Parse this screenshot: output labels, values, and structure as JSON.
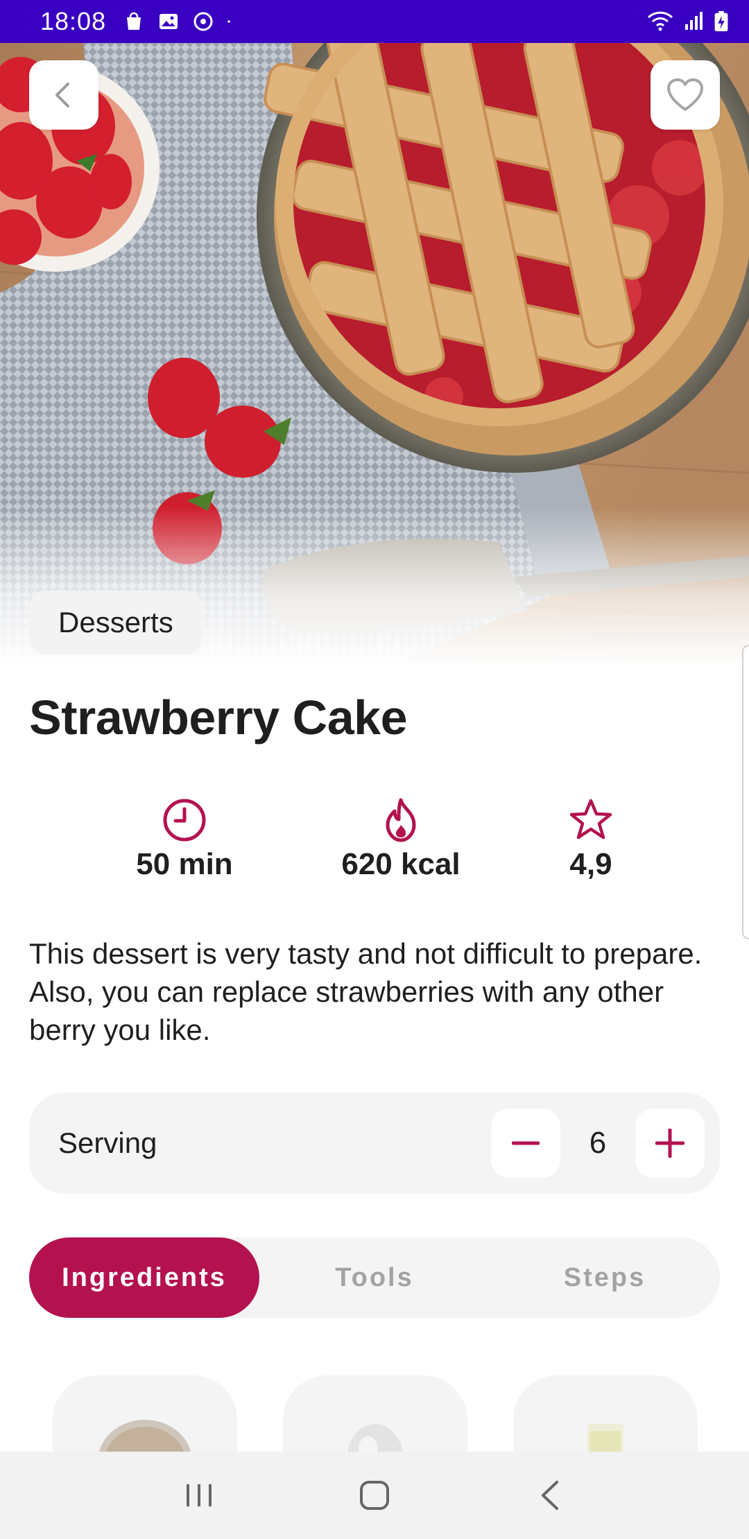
{
  "status_bar": {
    "time": "18:08",
    "left_icons": [
      "bag-icon",
      "image-icon",
      "sync-icon",
      "dot-icon"
    ],
    "right_icons": [
      "wifi-icon",
      "signal-icon",
      "battery-charging-icon"
    ],
    "background": "#3a00c2"
  },
  "header": {
    "back_icon": "chevron-left-icon",
    "favorite_icon": "heart-outline-icon"
  },
  "recipe": {
    "category": "Desserts",
    "title": "Strawberry Cake",
    "stats": [
      {
        "icon": "clock-icon",
        "value": "50 min"
      },
      {
        "icon": "flame-icon",
        "value": "620 kcal"
      },
      {
        "icon": "star-icon",
        "value": "4,9"
      }
    ],
    "description": "This dessert is very tasty and not difficult to prepare. Also, you can replace strawberries with any other berry you like."
  },
  "serving": {
    "label": "Serving",
    "value": "6",
    "decrement_icon": "minus-icon",
    "increment_icon": "plus-icon"
  },
  "tabs": [
    {
      "label": "Ingredients",
      "active": true
    },
    {
      "label": "Tools",
      "active": false
    },
    {
      "label": "Steps",
      "active": false
    }
  ],
  "ingredients": [
    {
      "icon": "flour-bowl-icon"
    },
    {
      "icon": "egg-icon"
    },
    {
      "icon": "milk-glass-icon"
    }
  ],
  "nav_bar": {
    "buttons": [
      "recent-apps-icon",
      "home-icon",
      "back-icon"
    ]
  },
  "colors": {
    "accent": "#b3124f",
    "tab_inactive_text": "#a3a3a3",
    "surface": "#f4f4f4"
  }
}
